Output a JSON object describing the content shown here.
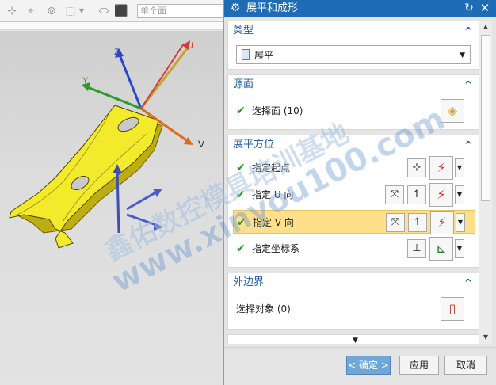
{
  "toolbar": {
    "selection_filter": "单个面"
  },
  "viewport": {
    "axis_labels": {
      "z": "Z",
      "y": "Y",
      "v": "V",
      "u": "U"
    }
  },
  "dialog": {
    "title": "展平和成形",
    "sections": {
      "type": {
        "header": "类型",
        "selected": "展平"
      },
      "source_face": {
        "header": "源面",
        "select_label": "选择面 (10)"
      },
      "orientation": {
        "header": "展平方位",
        "rows": [
          {
            "label": "指定起点"
          },
          {
            "label": "指定 U 向"
          },
          {
            "label": "指定 V 向"
          },
          {
            "label": "指定坐标系"
          }
        ]
      },
      "outer_boundary": {
        "header": "外边界",
        "select_label": "选择对象 (0)"
      }
    },
    "buttons": {
      "ok": "< 确定 >",
      "apply": "应用",
      "cancel": "取消"
    }
  },
  "watermark": {
    "line1": "鑫佑数控模具培训基地",
    "line2": "www.xinyou100.com"
  },
  "colors": {
    "title_bar": "#1d6cb5",
    "section_header": "#1f5fa6",
    "highlight_row": "#ffe08a",
    "check": "#1f9a1f",
    "part_yellow": "#f2ea2a"
  }
}
